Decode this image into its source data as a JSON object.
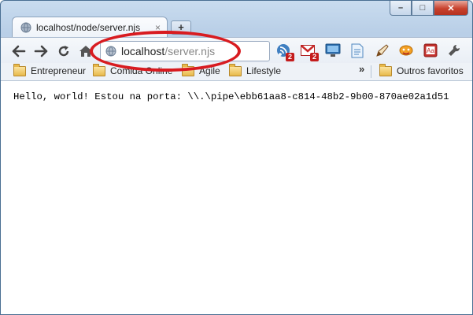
{
  "window": {
    "controls": {
      "minimize": "–",
      "maximize": "□",
      "close": "✕"
    }
  },
  "tab": {
    "title": "localhost/node/server.njs",
    "close_glyph": "×",
    "new_tab_glyph": "+"
  },
  "toolbar": {
    "icons": [
      "back-arrow-icon",
      "forward-arrow-icon",
      "reload-icon",
      "home-icon"
    ],
    "address": {
      "host": "localhost",
      "path": "/server.njs"
    },
    "extensions": [
      {
        "icon": "rss-icon",
        "badge": "2"
      },
      {
        "icon": "gmail-icon",
        "badge": "2"
      },
      {
        "icon": "monitor-icon"
      },
      {
        "icon": "document-icon"
      },
      {
        "icon": "pen-icon"
      },
      {
        "icon": "bug-icon"
      },
      {
        "icon": "dictionary-icon"
      },
      {
        "icon": "wrench-icon"
      }
    ]
  },
  "bookmarks": {
    "items": [
      "Entrepreneur",
      "Comida Online",
      "Agile",
      "Lifestyle"
    ],
    "overflow": "»",
    "other": "Outros favoritos"
  },
  "page": {
    "body_text": "Hello, world! Estou na porta: \\\\.\\pipe\\ebb61aa8-c814-48b2-9b00-870ae02a1d51"
  },
  "colors": {
    "highlight_ellipse": "#d81b20",
    "frame": "#b9cfe7"
  }
}
